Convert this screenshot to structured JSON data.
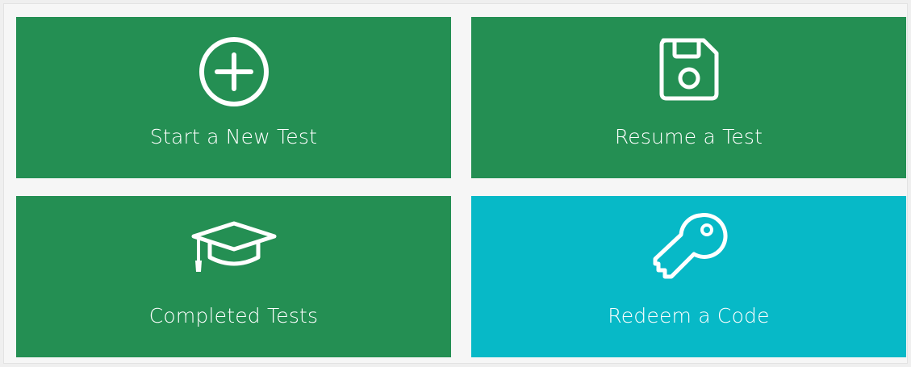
{
  "colors": {
    "green": "#248f53",
    "teal": "#07b9c7",
    "icon": "#ffffff"
  },
  "tiles": [
    {
      "label": "Start a New Test",
      "icon": "plus-circle-icon"
    },
    {
      "label": "Resume a Test",
      "icon": "floppy-disk-icon"
    },
    {
      "label": "Completed Tests",
      "icon": "graduation-cap-icon"
    },
    {
      "label": "Redeem a Code",
      "icon": "key-icon"
    }
  ]
}
